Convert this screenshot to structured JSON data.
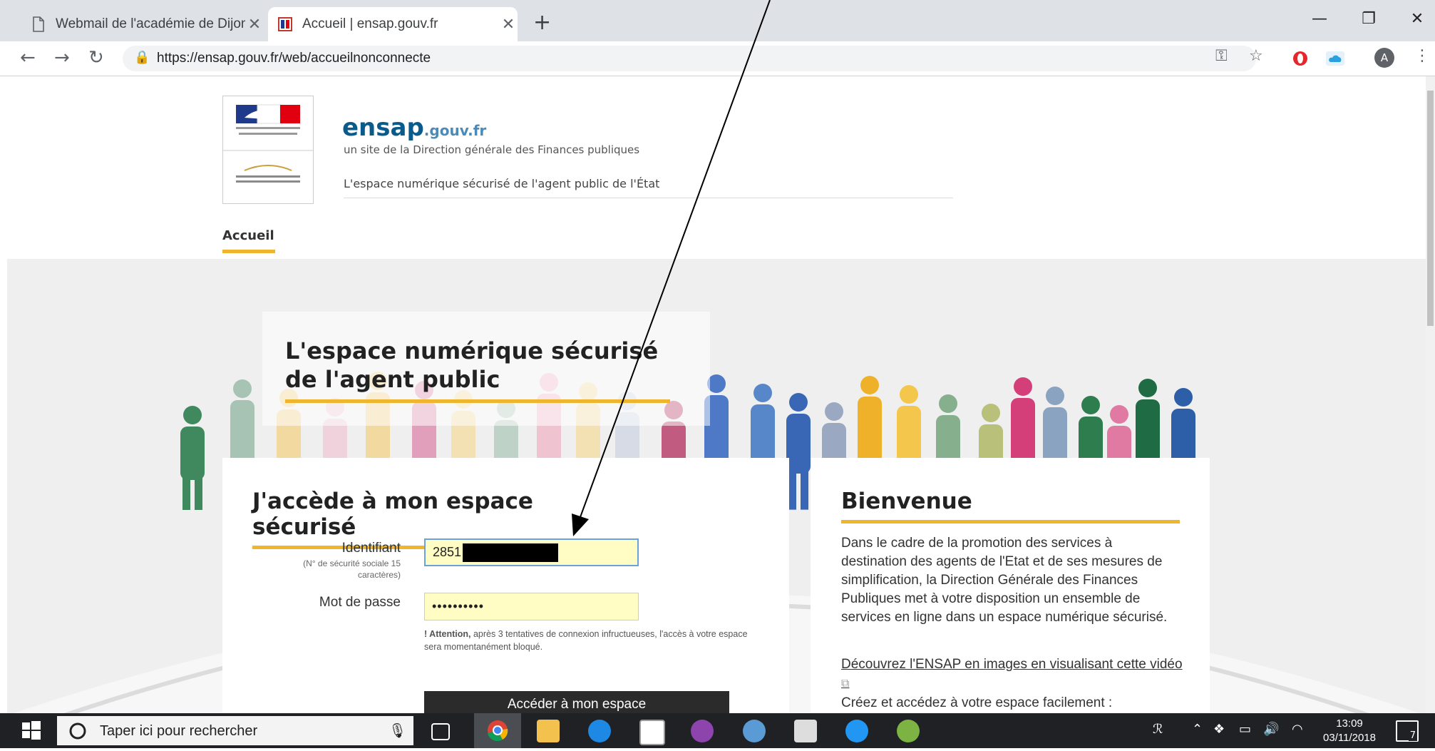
{
  "browser": {
    "tabs": [
      {
        "title": "Webmail de l'académie de Dijon"
      },
      {
        "title": "Accueil | ensap.gouv.fr"
      }
    ],
    "url": "https://ensap.gouv.fr/web/accueilnonconnecte",
    "profile_initial": "A"
  },
  "site": {
    "brand_main": "ensap",
    "brand_suffix": ".gouv.fr",
    "subtitle": "un site de la Direction générale des Finances publiques",
    "tagline": "L'espace numérique sécurisé de l'agent public de l'État",
    "nav": [
      "Accueil"
    ],
    "hero_title_line1": "L'espace numérique sécurisé",
    "hero_title_line2": "de l'agent public"
  },
  "login": {
    "title": "J'accède à mon espace sécurisé",
    "identifier_label": "Identifiant",
    "identifier_hint_line1": "(N° de sécurité sociale 15",
    "identifier_hint_line2": "caractères)",
    "identifier_value": "2851",
    "password_label": "Mot de passe",
    "password_value": "••••••••••",
    "warning_bold": "! Attention,",
    "warning_text": " après 3 tentatives de connexion infructueuses, l'accès à votre espace sera momentanément bloqué.",
    "submit_label": "Accéder à mon espace"
  },
  "welcome": {
    "title": "Bienvenue",
    "text": "Dans le cadre de la promotion des services à destination des agents de l'Etat et de ses mesures de simplification, la Direction Générale des Finances Publiques met à votre disposition un ensemble de services en ligne dans un espace numérique sécurisé.",
    "link_text": "Découvrez l'ENSAP en images en visualisant cette vidéo",
    "more_text": "Créez et accédez à votre espace facilement :"
  },
  "taskbar": {
    "search_placeholder": "Taper ici pour rechercher",
    "time": "13:09",
    "date": "03/11/2018",
    "notification_count": "7"
  }
}
